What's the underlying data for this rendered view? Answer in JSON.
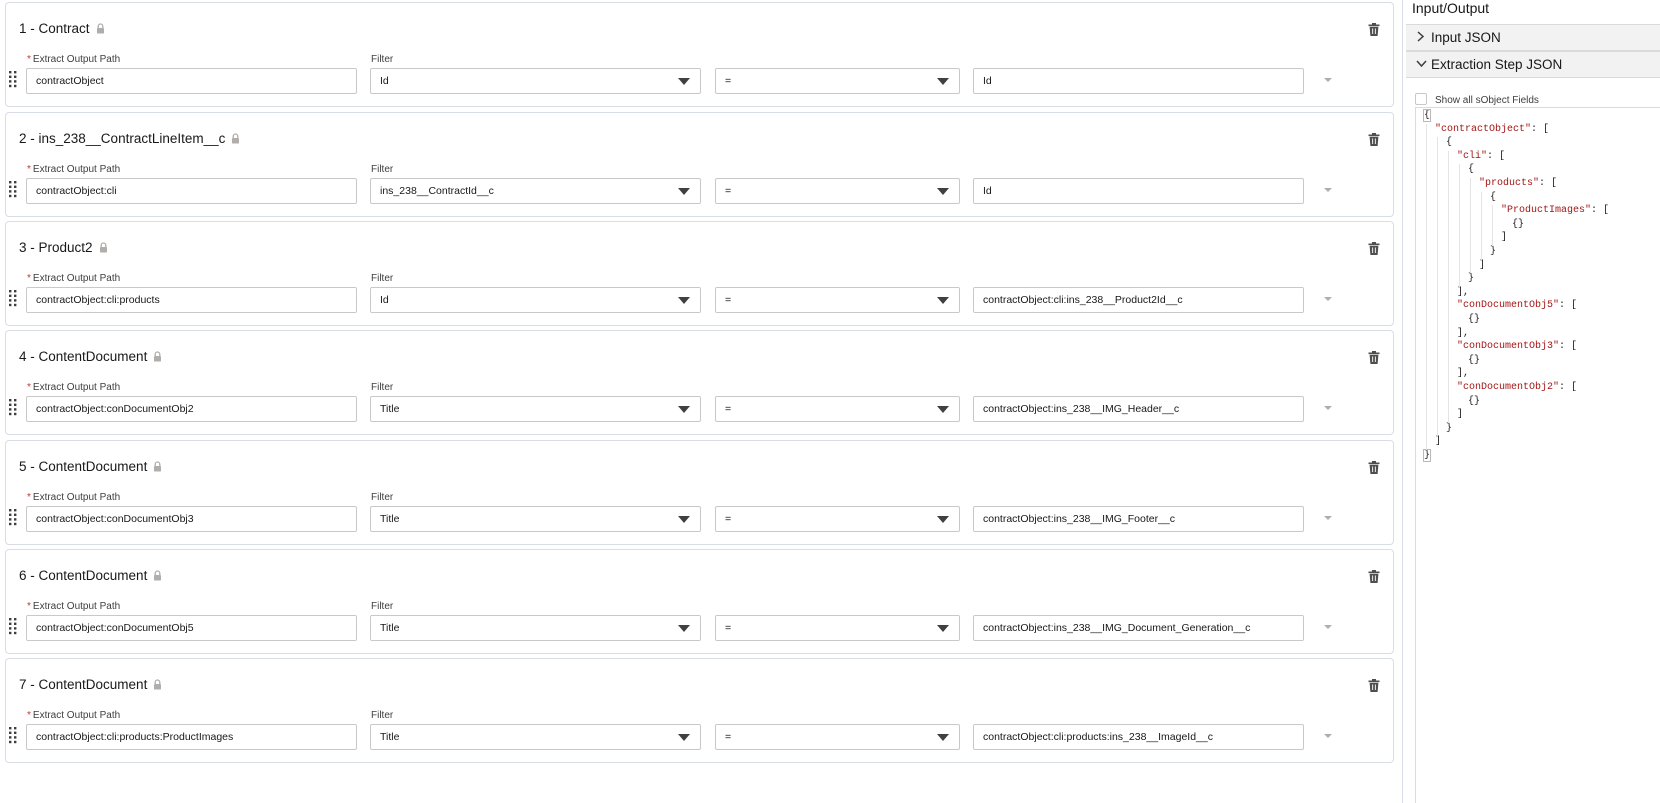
{
  "steps": [
    {
      "title": "1 - Contract",
      "path_label": "Extract Output Path",
      "path": "contractObject",
      "filter_label": "Filter",
      "filter": "Id",
      "operator": "=",
      "value": "Id"
    },
    {
      "title": "2 - ins_238__ContractLineItem__c",
      "path_label": "Extract Output Path",
      "path": "contractObject:cli",
      "filter_label": "Filter",
      "filter": "ins_238__ContractId__c",
      "operator": "=",
      "value": "Id"
    },
    {
      "title": "3 - Product2",
      "path_label": "Extract Output Path",
      "path": "contractObject:cli:products",
      "filter_label": "Filter",
      "filter": "Id",
      "operator": "=",
      "value": "contractObject:cli:ins_238__Product2Id__c"
    },
    {
      "title": "4 - ContentDocument",
      "path_label": "Extract Output Path",
      "path": "contractObject:conDocumentObj2",
      "filter_label": "Filter",
      "filter": "Title",
      "operator": "=",
      "value": "contractObject:ins_238__IMG_Header__c"
    },
    {
      "title": "5 - ContentDocument",
      "path_label": "Extract Output Path",
      "path": "contractObject:conDocumentObj3",
      "filter_label": "Filter",
      "filter": "Title",
      "operator": "=",
      "value": "contractObject:ins_238__IMG_Footer__c"
    },
    {
      "title": "6 - ContentDocument",
      "path_label": "Extract Output Path",
      "path": "contractObject:conDocumentObj5",
      "filter_label": "Filter",
      "filter": "Title",
      "operator": "=",
      "value": "contractObject:ins_238__IMG_Document_Generation__c"
    },
    {
      "title": "7 - ContentDocument",
      "path_label": "Extract Output Path",
      "path": "contractObject:cli:products:ProductImages",
      "filter_label": "Filter",
      "filter": "Title",
      "operator": "=",
      "value": "contractObject:cli:products:ins_238__ImageId__c"
    }
  ],
  "required_mark": "*",
  "panel": {
    "title": "Input/Output",
    "input_json_label": "Input JSON",
    "extraction_json_label": "Extraction Step JSON",
    "show_all_label": "Show all sObject Fields",
    "json_lines": [
      {
        "indent": 0,
        "key": "",
        "text": "{"
      },
      {
        "indent": 1,
        "key": "\"contractObject\"",
        "text": ": ["
      },
      {
        "indent": 2,
        "key": "",
        "text": "{"
      },
      {
        "indent": 3,
        "key": "\"cli\"",
        "text": ": ["
      },
      {
        "indent": 4,
        "key": "",
        "text": "{"
      },
      {
        "indent": 5,
        "key": "\"products\"",
        "text": ": ["
      },
      {
        "indent": 6,
        "key": "",
        "text": "{"
      },
      {
        "indent": 7,
        "key": "\"ProductImages\"",
        "text": ": ["
      },
      {
        "indent": 8,
        "key": "",
        "text": "{}"
      },
      {
        "indent": 7,
        "key": "",
        "text": "]"
      },
      {
        "indent": 6,
        "key": "",
        "text": "}"
      },
      {
        "indent": 5,
        "key": "",
        "text": "]"
      },
      {
        "indent": 4,
        "key": "",
        "text": "}"
      },
      {
        "indent": 3,
        "key": "",
        "text": "],"
      },
      {
        "indent": 3,
        "key": "\"conDocumentObj5\"",
        "text": ": ["
      },
      {
        "indent": 4,
        "key": "",
        "text": "{}"
      },
      {
        "indent": 3,
        "key": "",
        "text": "],"
      },
      {
        "indent": 3,
        "key": "\"conDocumentObj3\"",
        "text": ": ["
      },
      {
        "indent": 4,
        "key": "",
        "text": "{}"
      },
      {
        "indent": 3,
        "key": "",
        "text": "],"
      },
      {
        "indent": 3,
        "key": "\"conDocumentObj2\"",
        "text": ": ["
      },
      {
        "indent": 4,
        "key": "",
        "text": "{}"
      },
      {
        "indent": 3,
        "key": "",
        "text": "]"
      },
      {
        "indent": 2,
        "key": "",
        "text": "}"
      },
      {
        "indent": 1,
        "key": "",
        "text": "]"
      },
      {
        "indent": 0,
        "key": "",
        "text": "}"
      }
    ]
  },
  "icons": {
    "lock": "lock-icon",
    "trash": "trash-icon",
    "drag": "drag-handle-icon",
    "chevron_right": "chevron-right-icon",
    "chevron_down": "chevron-down-icon"
  },
  "colors": {
    "json_key": "#a31515",
    "required": "#c23934",
    "border": "#d8dde6"
  }
}
